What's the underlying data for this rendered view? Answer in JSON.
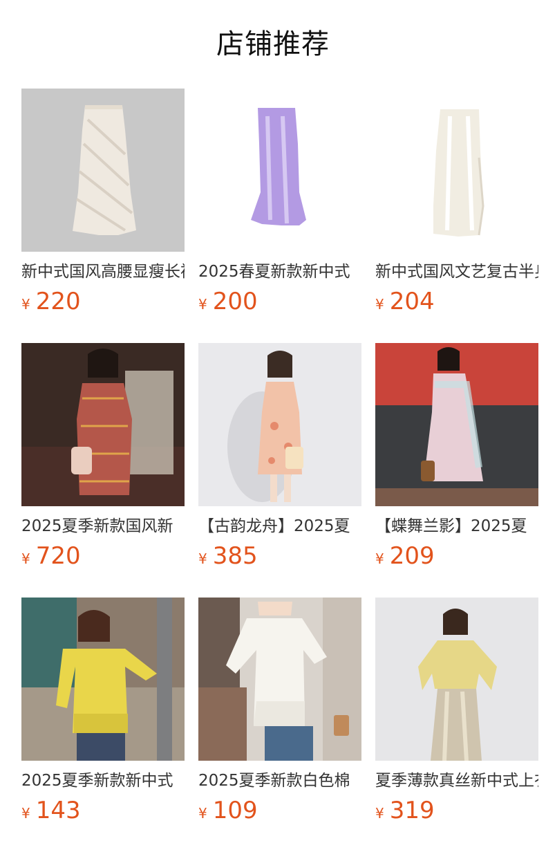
{
  "section": {
    "title": "店铺推荐"
  },
  "currency_symbol": "¥",
  "products": [
    {
      "name": "新中式国风高腰显瘦长裙",
      "price": "220",
      "image": "white-jacquard-skirt",
      "bg": "#c8c8c8",
      "color": "#efe9e0"
    },
    {
      "name": "2025春夏新款新中式",
      "price": "200",
      "image": "lavender-satin-skirt",
      "bg": "#ffffff",
      "color": "#b39ae3"
    },
    {
      "name": "新中式国风文艺复古半身裙",
      "price": "204",
      "image": "ivory-satin-skirt",
      "bg": "#ffffff",
      "color": "#f1ede2"
    },
    {
      "name": "2025夏季新款国风新",
      "price": "720",
      "image": "red-brocade-dress-photo",
      "bg": "#3a2a24",
      "color": "#b4574a"
    },
    {
      "name": "【古韵龙舟】2025夏",
      "price": "385",
      "image": "peach-print-dress-photo",
      "bg": "#e9e9ec",
      "color": "#f2c2a8"
    },
    {
      "name": "【蝶舞兰影】2025夏",
      "price": "209",
      "image": "pastel-qipao-dress-photo",
      "bg": "#c9443a",
      "color": "#e8cfd6"
    },
    {
      "name": "2025夏季新款新中式",
      "price": "143",
      "image": "yellow-top-photo",
      "bg": "#8b7b6c",
      "color": "#e9d64a"
    },
    {
      "name": "2025夏季新款白色棉",
      "price": "109",
      "image": "white-tee-photo",
      "bg": "#6b5a50",
      "color": "#f6f4ee"
    },
    {
      "name": "夏季薄款真丝新中式上衣",
      "price": "319",
      "image": "yellow-blouse-satin-skirt-photo",
      "bg": "#e6e6e8",
      "color": "#e6d787"
    }
  ]
}
